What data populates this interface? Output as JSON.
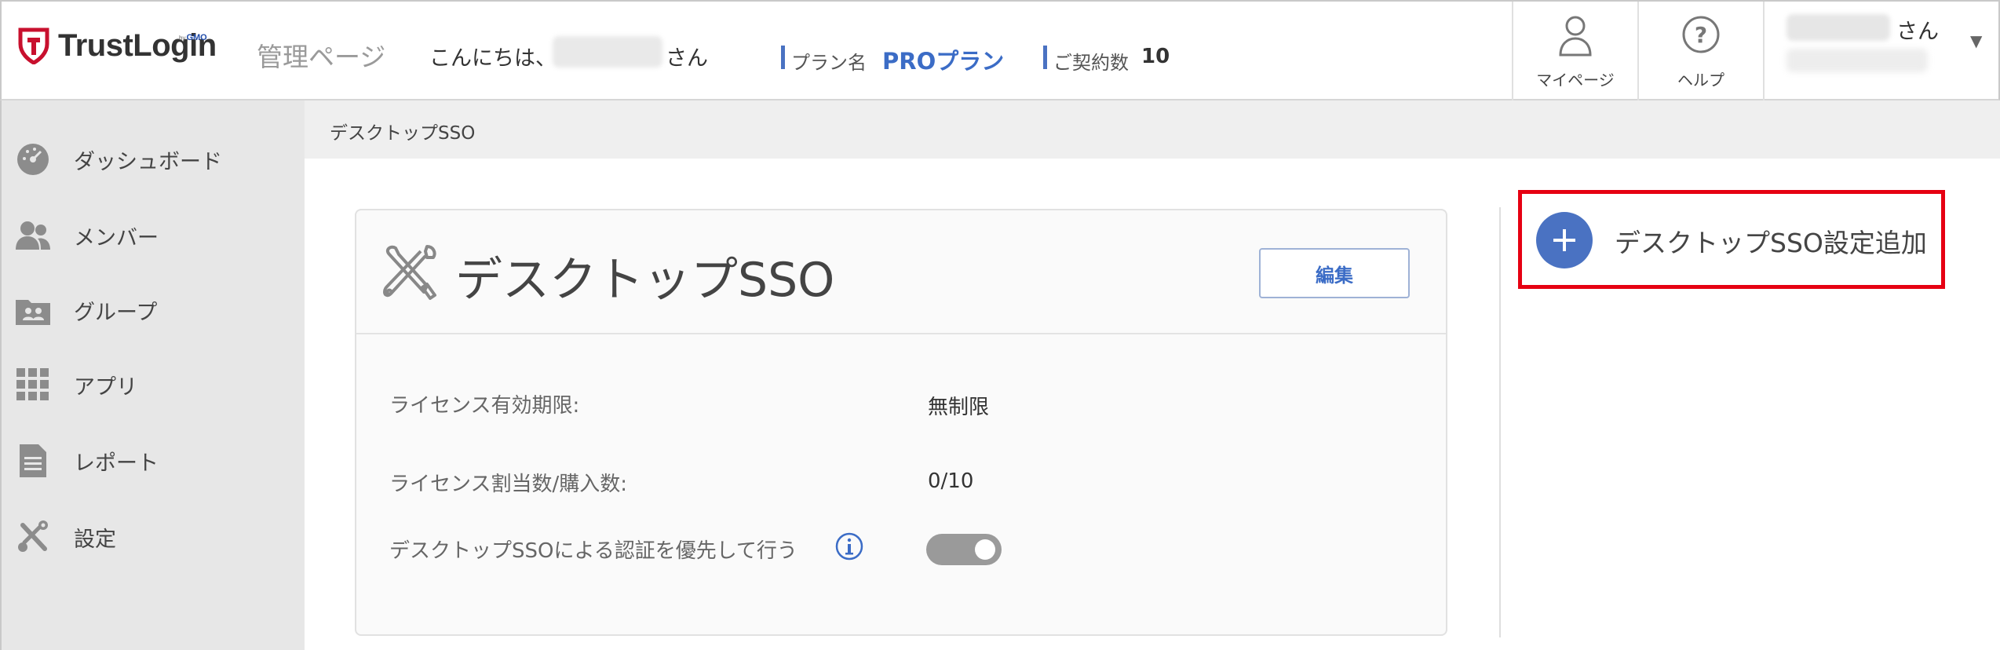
{
  "header": {
    "logo_text": "TrustLogin",
    "logo_sub_by": "by",
    "logo_sub_gmo": "GMO",
    "admin_title": "管理ページ",
    "greeting_prefix": "こんにちは、",
    "greeting_suffix": "さん",
    "plan_label": "プラン名",
    "plan_value": "PROプラン",
    "contract_label": "ご契約数",
    "contract_value": "10",
    "mypage_label": "マイページ",
    "help_label": "ヘルプ",
    "account_suffix": "さん"
  },
  "sidebar": {
    "items": [
      {
        "label": "ダッシュボード",
        "icon": "dashboard-icon"
      },
      {
        "label": "メンバー",
        "icon": "members-icon"
      },
      {
        "label": "グループ",
        "icon": "group-icon"
      },
      {
        "label": "アプリ",
        "icon": "apps-grid-icon"
      },
      {
        "label": "レポート",
        "icon": "report-icon"
      },
      {
        "label": "設定",
        "icon": "tools-icon"
      }
    ]
  },
  "breadcrumb": "デスクトップSSO",
  "card": {
    "title": "デスクトップSSO",
    "edit_label": "編集",
    "rows": [
      {
        "label": "ライセンス有効期限:",
        "value": "無制限"
      },
      {
        "label": "ライセンス割当数/購入数:",
        "value": "0/10"
      },
      {
        "label": "デスクトップSSOによる認証を優先して行う",
        "value": ""
      }
    ],
    "priority_toggle_on": true
  },
  "add_button_label": "デスクトップSSO設定追加",
  "colors": {
    "accent": "#3b6cc6",
    "brand_red": "#c8102e",
    "highlight_red": "#e60012",
    "sidebar_bg": "#e7e7e7",
    "toggle_bg": "#9a9a9a"
  }
}
